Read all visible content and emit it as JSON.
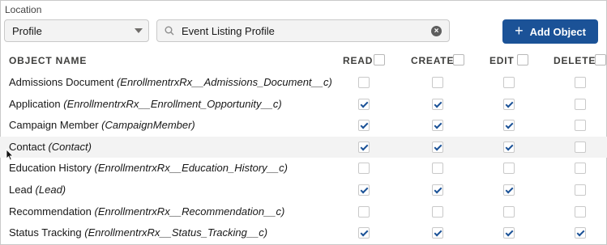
{
  "location": {
    "label": "Location",
    "select_value": "Profile",
    "search_value": "Event Listing Profile",
    "clear_icon": "clear-icon",
    "search_icon": "search-icon"
  },
  "toolbar": {
    "add_object_label": "Add Object",
    "add_icon": "plus-icon"
  },
  "table": {
    "headers": {
      "object_name": "OBJECT NAME",
      "read": "READ",
      "create": "CREATE",
      "edit": "EDIT",
      "delete": "DELETE"
    },
    "rows": [
      {
        "name": "Admissions Document",
        "api": "(EnrollmentrxRx__Admissions_Document__c)",
        "read": false,
        "create": false,
        "edit": false,
        "delete": false
      },
      {
        "name": "Application",
        "api": "(EnrollmentrxRx__Enrollment_Opportunity__c)",
        "read": true,
        "create": true,
        "edit": true,
        "delete": false
      },
      {
        "name": "Campaign Member",
        "api": "(CampaignMember)",
        "read": true,
        "create": true,
        "edit": true,
        "delete": false
      },
      {
        "name": "Contact",
        "api": "(Contact)",
        "read": true,
        "create": true,
        "edit": true,
        "delete": false
      },
      {
        "name": "Education History",
        "api": "(EnrollmentrxRx__Education_History__c)",
        "read": false,
        "create": false,
        "edit": false,
        "delete": false
      },
      {
        "name": "Lead",
        "api": "(Lead)",
        "read": true,
        "create": true,
        "edit": true,
        "delete": false
      },
      {
        "name": "Recommendation",
        "api": "(EnrollmentrxRx__Recommendation__c)",
        "read": false,
        "create": false,
        "edit": false,
        "delete": false
      },
      {
        "name": "Status Tracking",
        "api": "(EnrollmentrxRx__Status_Tracking__c)",
        "read": true,
        "create": true,
        "edit": true,
        "delete": true
      }
    ]
  },
  "colors": {
    "accent": "#1b5297",
    "row_highlight": "#f3f3f3"
  }
}
